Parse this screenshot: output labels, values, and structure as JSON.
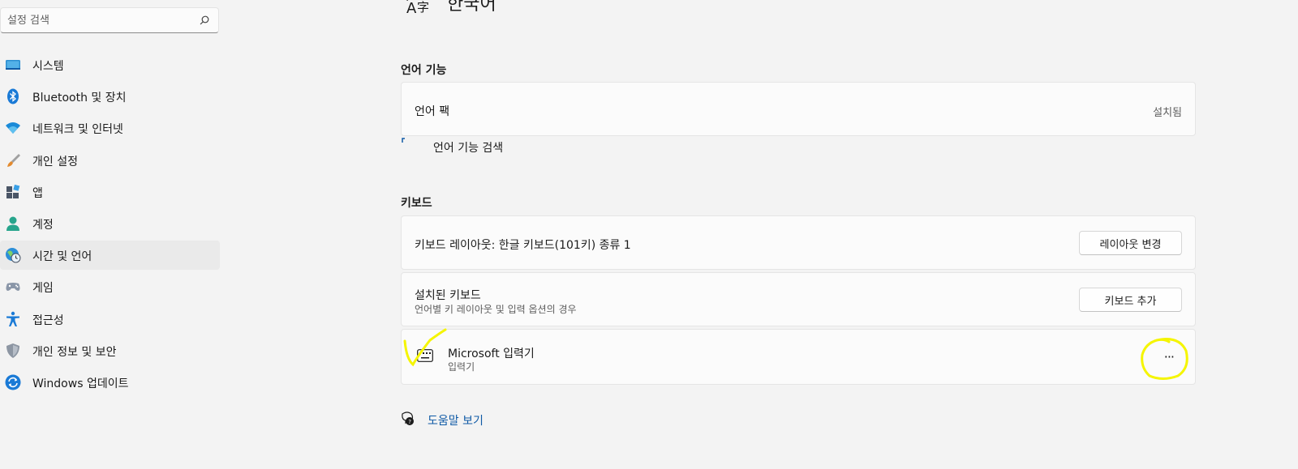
{
  "search": {
    "placeholder": "설정 검색"
  },
  "sidebar": {
    "items": [
      {
        "label": "시스템",
        "icon": "system-icon"
      },
      {
        "label": "Bluetooth 및 장치",
        "icon": "bluetooth-icon"
      },
      {
        "label": "네트워크 및 인터넷",
        "icon": "wifi-icon"
      },
      {
        "label": "개인 설정",
        "icon": "brush-icon"
      },
      {
        "label": "앱",
        "icon": "apps-icon"
      },
      {
        "label": "계정",
        "icon": "account-icon"
      },
      {
        "label": "시간 및 언어",
        "icon": "globe-clock-icon",
        "selected": true
      },
      {
        "label": "게임",
        "icon": "gamepad-icon"
      },
      {
        "label": "접근성",
        "icon": "accessibility-icon"
      },
      {
        "label": "개인 정보 및 보안",
        "icon": "shield-icon"
      },
      {
        "label": "Windows 업데이트",
        "icon": "update-icon"
      }
    ]
  },
  "header": {
    "title": "한국어",
    "icon": "language-icon"
  },
  "language_features": {
    "title": "언어 기능",
    "pack": {
      "label": "언어 팩",
      "status": "설치됨"
    },
    "search_link": "언어 기능 검색"
  },
  "keyboard": {
    "title": "키보드",
    "layout": {
      "label": "키보드 레이아웃: 한글 키보드(101키) 종류 1",
      "button": "레이아웃 변경"
    },
    "installed": {
      "label": "설치된 키보드",
      "sub": "언어별 키 레이아웃 및 입력 옵션의 경우",
      "button": "키보드 추가"
    },
    "ime": {
      "label": "Microsoft 입력기",
      "sub": "입력기",
      "more": "···"
    }
  },
  "help": {
    "label": "도움말 보기"
  },
  "colors": {
    "accent": "#0f5aa6",
    "annotation": "#f5f500"
  }
}
